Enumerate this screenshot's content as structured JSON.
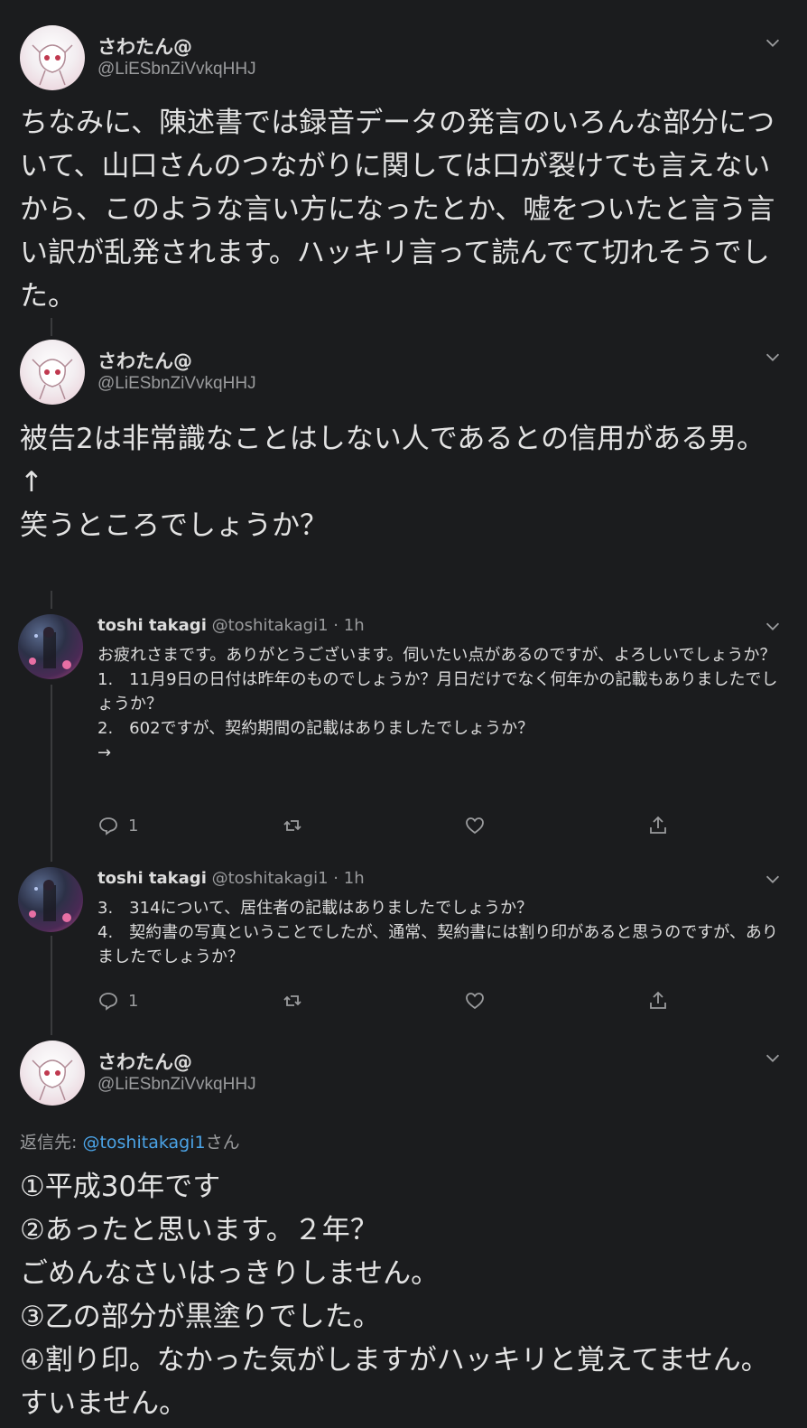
{
  "tweet1": {
    "name": "さわたん@",
    "handle": "@LiESbnZiVvkqHHJ",
    "text": "ちなみに、陳述書では録音データの発言のいろんな部分について、山口さんのつながりに関しては口が裂けても言えないから、このような言い方になったとか、嘘をついたと言う言い訳が乱発されます。ハッキリ言って読んでて切れそうでした。"
  },
  "tweet2": {
    "name": "さわたん@",
    "handle": "@LiESbnZiVvkqHHJ",
    "text": "被告2は非常識なことはしない人であるとの信用がある男。\n↑\n笑うところでしょうか？"
  },
  "reply1": {
    "name": "toshi takagi",
    "handle": "@toshitakagi1",
    "time": "· 1h",
    "text": "お疲れさまです。ありがとうございます。伺いたい点があるのですが、よろしいでしょうか？\n1.　11月9日の日付は昨年のものでしょうか？月日だけでなく何年かの記載もありましたでしょうか？\n2.　602ですが、契約期間の記載はありましたでしょうか？\n→",
    "reply_count": "1"
  },
  "reply2": {
    "name": "toshi takagi",
    "handle": "@toshitakagi1",
    "time": "· 1h",
    "text": "3.　314について、居住者の記載はありましたでしょうか？\n4.　契約書の写真ということでしたが、通常、契約書には割り印があると思うのですが、ありましたでしょうか？",
    "reply_count": "1"
  },
  "tweet3": {
    "name": "さわたん@",
    "handle": "@LiESbnZiVvkqHHJ",
    "replying_prefix": "返信先: ",
    "replying_link": "@toshitakagi1",
    "replying_suffix": "さん",
    "text": "①平成30年です\n②あったと思います。２年？\nごめんなさいはっきりしません。\n③乙の部分が黒塗りでした。\n④割り印。なかった気がしますがハッキリと覚えてません。すいません。"
  }
}
